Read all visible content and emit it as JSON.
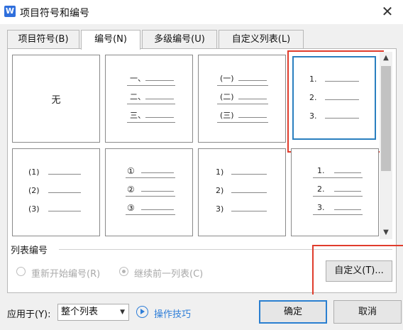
{
  "window": {
    "title": "项目符号和编号",
    "app_icon_letter": "W",
    "close_symbol": "✕"
  },
  "tabs": [
    {
      "label": "项目符号(B)",
      "active": false
    },
    {
      "label": "编号(N)",
      "active": true
    },
    {
      "label": "多级编号(U)",
      "active": false
    },
    {
      "label": "自定义列表(L)",
      "active": false
    }
  ],
  "styles": {
    "none_label": "无",
    "cells": [
      {
        "markers": []
      },
      {
        "markers": [
          "一、",
          "二、",
          "三、"
        ]
      },
      {
        "markers": [
          "(一)",
          "(二)",
          "(三)"
        ]
      },
      {
        "markers": [
          "1.",
          "2.",
          "3."
        ],
        "selected": true
      },
      {
        "markers": [
          "(1)",
          "(2)",
          "(3)"
        ]
      },
      {
        "markers": [
          "①",
          "②",
          "③"
        ]
      },
      {
        "markers": [
          "1)",
          "2)",
          "3)"
        ]
      },
      {
        "markers": [
          "1.",
          "2.",
          "3."
        ]
      }
    ]
  },
  "list_numbering": {
    "group_label": "列表编号",
    "restart_label": "重新开始编号(R)",
    "continue_label": "继续前一列表(C)",
    "custom_button": "自定义(T)..."
  },
  "footer": {
    "apply_label": "应用于(Y):",
    "apply_value": "整个列表",
    "tips_label": "操作技巧",
    "ok_label": "确定",
    "cancel_label": "取消"
  },
  "colors": {
    "highlight": "#e03c2c",
    "selected_border": "#2a7fbf",
    "link": "#2e7ed8"
  }
}
